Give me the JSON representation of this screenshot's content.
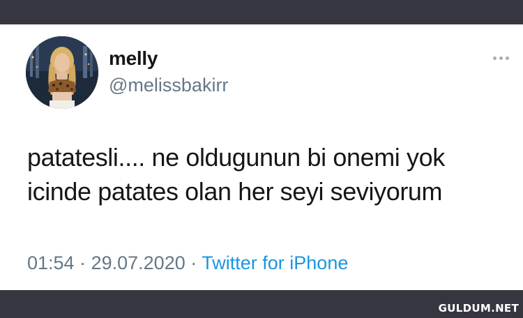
{
  "tweet": {
    "display_name": "melly",
    "handle": "@melissbakirr",
    "text_lines": [
      "patatesli.... ne oldugunun bi onemi yok",
      "icinde patates olan her seyi seviyorum"
    ],
    "time": "01:54",
    "date": "29.07.2020",
    "separator": "·",
    "source": "Twitter for iPhone",
    "more_icon": "more-horizontal-icon",
    "avatar_icon": "profile-photo"
  },
  "watermark": "GULDUM.NET",
  "colors": {
    "frame": "#363640",
    "card": "#ffffff",
    "text": "#14171a",
    "secondary": "#657786",
    "link": "#1b95e0"
  }
}
